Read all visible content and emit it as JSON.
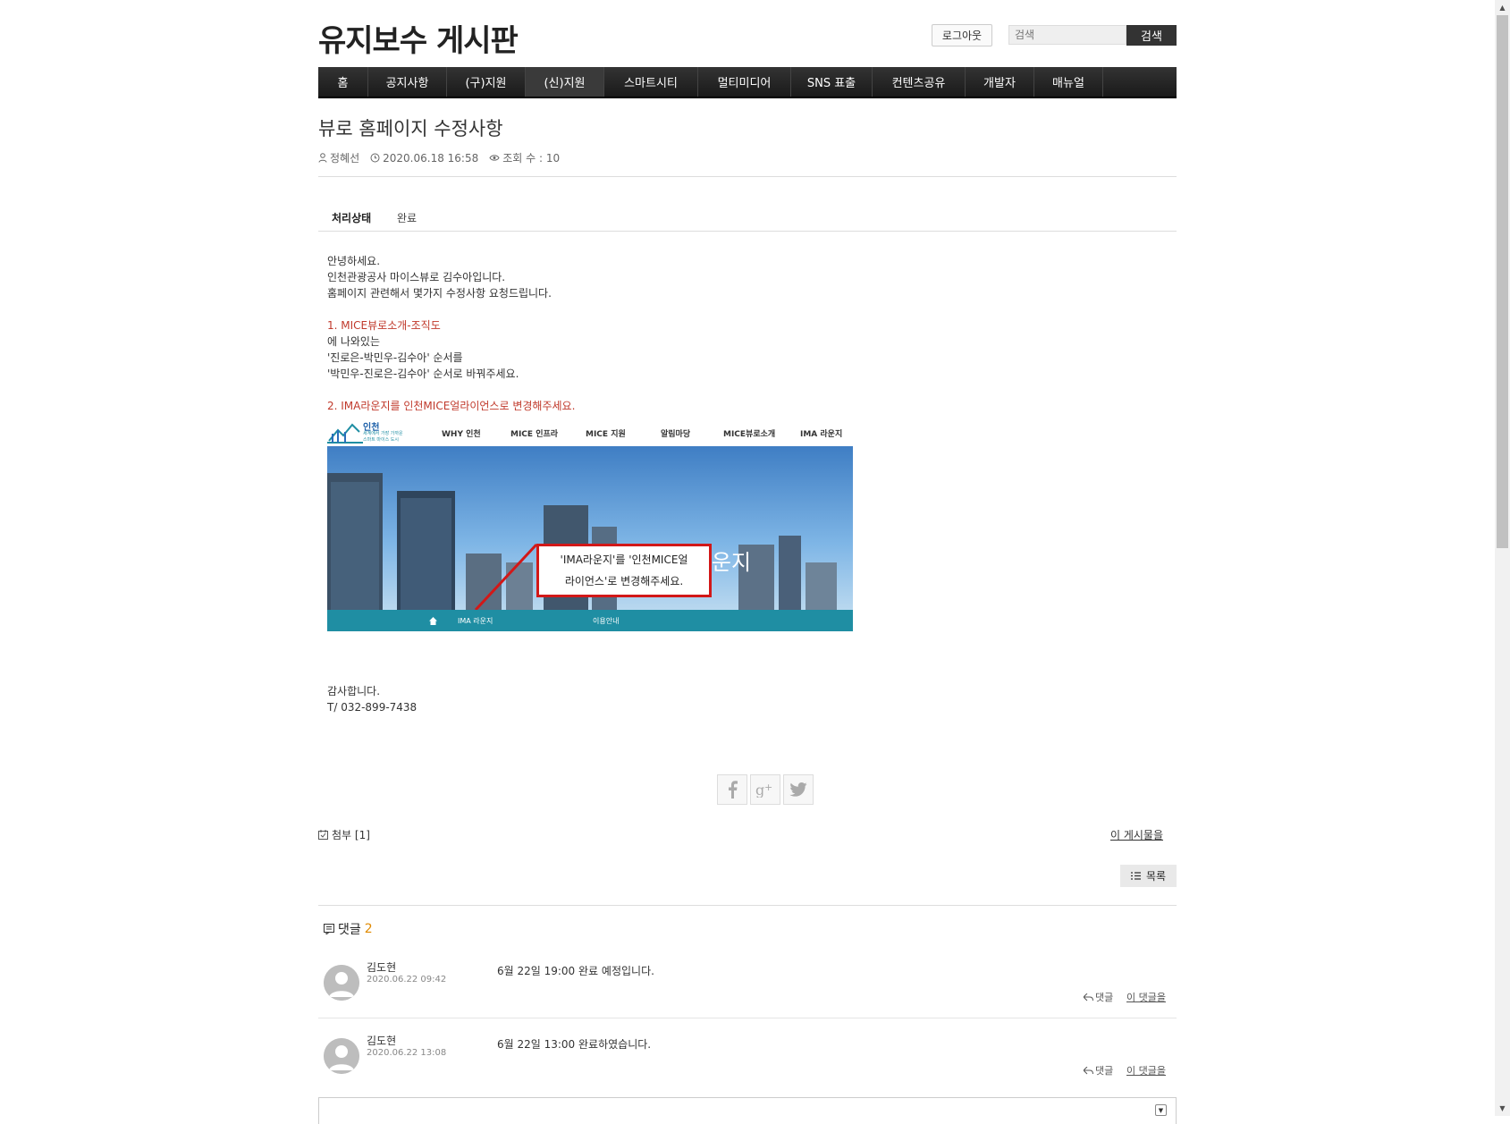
{
  "header": {
    "site_title": "유지보수 게시판",
    "logout_label": "로그아웃",
    "search_placeholder": "검색",
    "search_label": "검색"
  },
  "nav": {
    "items": [
      {
        "label": "홈"
      },
      {
        "label": "공지사항"
      },
      {
        "label": "(구)지원"
      },
      {
        "label": "(신)지원"
      },
      {
        "label": "스마트시티"
      },
      {
        "label": "멀티미디어"
      },
      {
        "label": "SNS 표출"
      },
      {
        "label": "컨텐츠공유"
      },
      {
        "label": "개발자"
      },
      {
        "label": "매뉴얼"
      }
    ]
  },
  "post": {
    "title": "뷰로 홈페이지 수정사항",
    "author": "정혜선",
    "datetime": "2020.06.18 16:58",
    "views": "조회 수 : 10",
    "status_label": "처리상태",
    "status_value": "완료",
    "body": {
      "line1": "안녕하세요.",
      "line2": "인천관광공사 마이스뷰로 김수아입니다.",
      "line3": "홈페이지 관련해서 몇가지 수정사항 요청드립니다.",
      "item1_title": "1. MICE뷰로소개-조직도",
      "item1_l1": "에 나와있는",
      "item1_l2": "'진로은-박민우-김수아' 순서를",
      "item1_l3": "'박민우-진로은-김수아' 순서로 바꿔주세요.",
      "item2_title": "2. IMA라운지를 인천MICE얼라이언스로 변경해주세요.",
      "thanks": "감사합니다.",
      "phone": "T/ 032-899-7438"
    },
    "screenshot": {
      "logo_text": "인천",
      "logo_sub1": "세계에서 가장 가까운",
      "logo_sub2": "스마트 마이스 도시",
      "menu": [
        "WHY 인천",
        "MICE 인프라",
        "MICE 지원",
        "알림마당",
        "MICE뷰로소개",
        "IMA 라운지"
      ],
      "banner_title": "IMA 라운지",
      "callout_l1": "'IMA라운지'를  '인천MICE얼",
      "callout_l2": "라이언스'로  변경해주세요.",
      "crumb1": "IMA 라운지",
      "crumb2": "이용안내"
    },
    "attach_label": "첨부 [1]",
    "this_post_label": "이 게시물을",
    "list_label": "목록"
  },
  "comments": {
    "label": "댓글",
    "count": "2",
    "items": [
      {
        "author": "김도현",
        "date": "2020.06.22 09:42",
        "text": "6월 22일 19:00 완료 예정입니다.",
        "reply": "댓글",
        "this": "이 댓글을"
      },
      {
        "author": "김도현",
        "date": "2020.06.22 13:08",
        "text": "6월 22일 13:00 완료하였습니다.",
        "reply": "댓글",
        "this": "이 댓글을"
      }
    ]
  },
  "colors": {
    "accent_red": "#c0392b",
    "nav_bg": "#222222",
    "comment_count": "#e08a00"
  }
}
